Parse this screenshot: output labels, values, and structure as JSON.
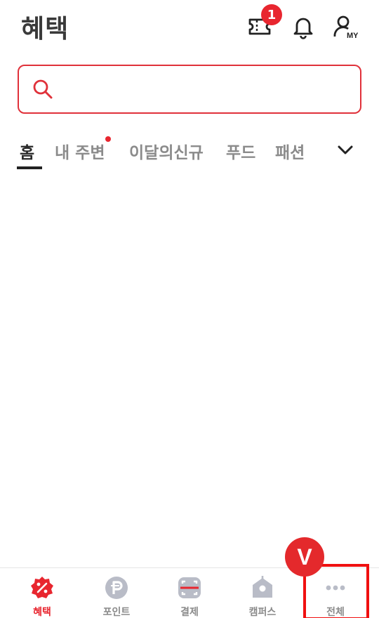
{
  "header": {
    "title": "혜택",
    "coupon_badge": "1",
    "icons": {
      "coupon": "coupon-icon",
      "bell": "bell-icon",
      "my": "my-account-icon"
    },
    "my_label": "MY"
  },
  "search": {
    "placeholder": "",
    "value": ""
  },
  "tabs": [
    {
      "label": "홈",
      "active": true
    },
    {
      "label": "내 주변",
      "has_dot": true
    },
    {
      "label": "이달의신규"
    },
    {
      "label": "푸드"
    },
    {
      "label": "패션"
    }
  ],
  "bottom_nav": [
    {
      "label": "혜택",
      "icon": "benefit-icon",
      "active": true
    },
    {
      "label": "포인트",
      "icon": "point-icon"
    },
    {
      "label": "결제",
      "icon": "payment-icon"
    },
    {
      "label": "캠퍼스",
      "icon": "campus-icon"
    },
    {
      "label": "전체",
      "icon": "more-icon"
    }
  ],
  "annotation": {
    "marker_label": "V"
  },
  "colors": {
    "accent": "#e8262f",
    "inactive": "#8a8a8a",
    "text": "#2a2a2a"
  }
}
